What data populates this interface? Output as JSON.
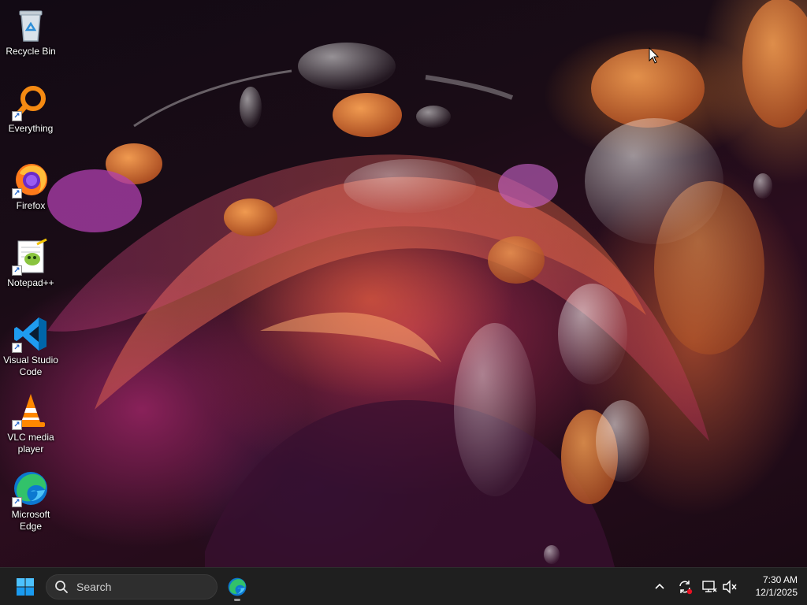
{
  "desktop": {
    "icons": [
      {
        "label": "Recycle Bin",
        "icon": "recycle-bin-icon",
        "shortcut": false
      },
      {
        "label": "Everything",
        "icon": "everything-search-icon",
        "shortcut": true
      },
      {
        "label": "Firefox",
        "icon": "firefox-icon",
        "shortcut": true
      },
      {
        "label": "Notepad++",
        "icon": "notepad-plus-plus-icon",
        "shortcut": true
      },
      {
        "label": "Visual Studio Code",
        "icon": "vscode-icon",
        "shortcut": true
      },
      {
        "label": "VLC media player",
        "icon": "vlc-icon",
        "shortcut": true
      },
      {
        "label": "Microsoft Edge",
        "icon": "edge-icon",
        "shortcut": true
      }
    ],
    "wallpaper": "abstract-fluid-wallpaper"
  },
  "taskbar": {
    "start_icon": "windows-start-icon",
    "search": {
      "placeholder": "Search",
      "icon": "search-icon"
    },
    "pinned_apps": [
      {
        "name": "Microsoft Edge",
        "icon": "edge-icon"
      }
    ],
    "tray": {
      "overflow_icon": "chevron-up-icon",
      "icons": [
        "sync-alert-icon",
        "network-disconnected-icon",
        "volume-muted-icon"
      ]
    },
    "clock": {
      "time": "7:30 AM",
      "date": "12/1/2025"
    }
  },
  "colors": {
    "taskbar_bg": "#1f1f1f",
    "search_bg": "#2e2e2e",
    "accent_blue": "#0078d4",
    "alert_red": "#e81123"
  }
}
